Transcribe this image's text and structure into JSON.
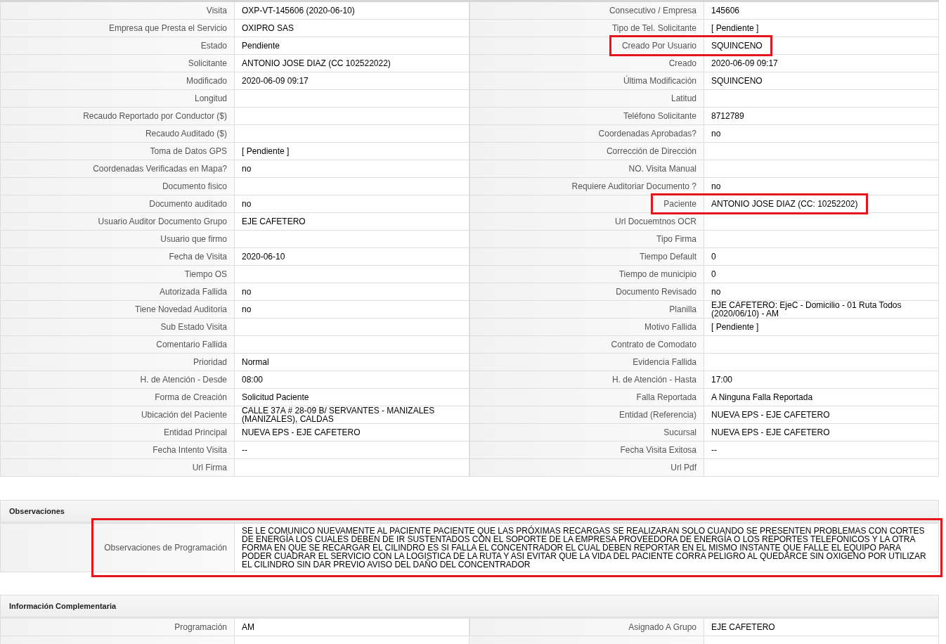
{
  "details": {
    "rows": [
      {
        "left": {
          "label": "Visita",
          "value": "OXP-VT-145606 (2020-06-10)",
          "highlighted": false
        },
        "right": {
          "label": "Consecutivo / Empresa",
          "value": "145606",
          "highlighted": false
        }
      },
      {
        "left": {
          "label": "Empresa que Presta el Servicio",
          "value": "OXIPRO SAS",
          "highlighted": false
        },
        "right": {
          "label": "Tipo de Tel. Solicitante",
          "value": "[ Pendiente ]",
          "highlighted": false
        }
      },
      {
        "left": {
          "label": "Estado",
          "value": "Pendiente",
          "highlighted": false
        },
        "right": {
          "label": "Creado Por Usuario",
          "value": "SQUINCENO",
          "highlighted": true
        }
      },
      {
        "left": {
          "label": "Solicitante",
          "value": "ANTONIO JOSE DIAZ (CC 102522022)",
          "highlighted": false
        },
        "right": {
          "label": "Creado",
          "value": "2020-06-09 09:17",
          "highlighted": false
        }
      },
      {
        "left": {
          "label": "Modificado",
          "value": "2020-06-09 09:17",
          "highlighted": false
        },
        "right": {
          "label": "Última Modificación",
          "value": "SQUINCENO",
          "highlighted": false
        }
      },
      {
        "left": {
          "label": "Longitud",
          "highlighted": false
        },
        "right": {
          "label": "Latitud",
          "highlighted": false
        }
      },
      {
        "left": {
          "label": "Recaudo Reportado por Conductor ($)",
          "highlighted": false
        },
        "right": {
          "label": "Teléfono Solicitante",
          "value": "8712789",
          "highlighted": false
        }
      },
      {
        "left": {
          "label": "Recaudo Auditado ($)",
          "highlighted": false
        },
        "right": {
          "label": "Coordenadas Aprobadas?",
          "value": "no",
          "highlighted": false
        }
      },
      {
        "left": {
          "label": "Toma de Datos GPS",
          "value": "[ Pendiente ]",
          "highlighted": false
        },
        "right": {
          "label": "Corrección de Dirección",
          "highlighted": false
        }
      },
      {
        "left": {
          "label": "Coordenadas Verificadas en Mapa?",
          "value": "no",
          "highlighted": false
        },
        "right": {
          "label": "NO. Visita Manual",
          "highlighted": false
        }
      },
      {
        "left": {
          "label": "Documento fisico",
          "highlighted": false
        },
        "right": {
          "label": "Requiere Auditoriar Documento ?",
          "value": "no",
          "highlighted": false
        }
      },
      {
        "left": {
          "label": "Documento auditado",
          "value": "no",
          "highlighted": false
        },
        "right": {
          "label": "Paciente",
          "value": "ANTONIO JOSE DIAZ (CC: 10252202)",
          "highlighted": true
        }
      },
      {
        "left": {
          "label": "Usuario Auditor Documento Grupo",
          "value": "EJE CAFETERO",
          "highlighted": false
        },
        "right": {
          "label": "Url Docuemtnos OCR",
          "highlighted": false
        }
      },
      {
        "left": {
          "label": "Usuario que firmo",
          "highlighted": false
        },
        "right": {
          "label": "Tipo Firma",
          "highlighted": false
        }
      },
      {
        "left": {
          "label": "Fecha de Visita",
          "value": "2020-06-10",
          "highlighted": false
        },
        "right": {
          "label": "Tiempo Default",
          "value": "0",
          "highlighted": false
        }
      },
      {
        "left": {
          "label": "Tiempo OS",
          "highlighted": false
        },
        "right": {
          "label": "Tiempo de municipio",
          "value": "0",
          "highlighted": false
        }
      },
      {
        "left": {
          "label": "Autorizada Fallida",
          "value": "no",
          "highlighted": false
        },
        "right": {
          "label": "Documento Revisado",
          "value": "no",
          "highlighted": false
        }
      },
      {
        "left": {
          "label": "Tiene Novedad Auditoria",
          "value": "no",
          "highlighted": false
        },
        "right": {
          "label": "Planilla",
          "value": "EJE CAFETERO: EjeC - Domicilio - 01 Ruta Todos (2020/06/10) - AM",
          "highlighted": false
        }
      },
      {
        "left": {
          "label": "Sub Estado Visita",
          "highlighted": false
        },
        "right": {
          "label": "Motivo Fallida",
          "value": "[ Pendiente ]",
          "highlighted": false
        }
      },
      {
        "left": {
          "label": "Comentario Fallida",
          "highlighted": false
        },
        "right": {
          "label": "Contrato de Comodato",
          "highlighted": false
        }
      },
      {
        "left": {
          "label": "Prioridad",
          "value": "Normal",
          "highlighted": false
        },
        "right": {
          "label": "Evidencia Fallida",
          "highlighted": false
        }
      },
      {
        "left": {
          "label": "H. de Atención - Desde",
          "value": "08:00",
          "highlighted": false
        },
        "right": {
          "label": "H. de Atención - Hasta",
          "value": "17:00",
          "highlighted": false
        }
      },
      {
        "left": {
          "label": "Forma de Creación",
          "value": "Solicitud Paciente",
          "highlighted": false
        },
        "right": {
          "label": "Falla Reportada",
          "value": "A Ninguna Falla Reportada",
          "highlighted": false
        }
      },
      {
        "left": {
          "label": "Ubicación del Paciente",
          "value": "CALLE 37A # 28-09 B/ SERVANTES - MANIZALES (MANIZALES), CALDAS",
          "highlighted": false
        },
        "right": {
          "label": "Entidad (Referencia)",
          "value": "NUEVA EPS - EJE CAFETERO",
          "highlighted": false
        }
      },
      {
        "left": {
          "label": "Entidad Principal",
          "value": "NUEVA EPS - EJE CAFETERO",
          "highlighted": false
        },
        "right": {
          "label": "Sucursal",
          "value": "NUEVA EPS - EJE CAFETERO",
          "highlighted": false
        }
      },
      {
        "left": {
          "label": "Fecha Intento Visita",
          "value": "--",
          "highlighted": false
        },
        "right": {
          "label": "Fecha Visita Exitosa",
          "value": "--",
          "highlighted": false
        }
      },
      {
        "left": {
          "label": "Url Firma",
          "highlighted": false
        },
        "right": {
          "label": "Url Pdf",
          "highlighted": false
        }
      }
    ]
  },
  "observations": {
    "title": "Observaciones",
    "rows": [
      {
        "label": "Observaciones de Programación",
        "value": "SE LE COMUNICO NUEVAMENTE AL PACIENTE PACIENTE QUE LAS PRÓXIMAS RECARGAS SE REALIZARAN SOLO CUANDO SE PRESENTEN PROBLEMAS CON CORTES DE ENERGÍA LOS CUALES DEBEN DE IR SUSTENTADOS CON EL SOPORTE DE LA EMPRESA PROVEEDORA DE ENERGÍA O LOS REPORTES TELEFONICOS Y LA OTRA FORMA EN QUE SE RECARGAR EL CILINDRO ES SI FALLA EL CONCENTRADOR EL CUAL DEBEN REPORTAR EN EL MISMO INSTANTE QUE FALLE EL EQUIPO PARA PODER CUADRAR EL SERVICIO CON LA LOGISTICA DE LA RUTA Y ASI EVITAR QUE LA VIDA DEL PACIENTE CORRA PELIGRO AL QUEDARCE SIN OXIGENO POR UTILIZAR EL CILINDRO SIN DAR PREVIO AVISO DEL DAÑO DEL CONCENTRADOR",
        "highlighted": true
      }
    ]
  },
  "complementary": {
    "title": "Información Complementaria",
    "rows": [
      {
        "left": {
          "label": "Programación",
          "value": "AM",
          "highlighted": false
        },
        "right": {
          "label": "Asignado A Grupo",
          "value": "EJE CAFETERO",
          "highlighted": false
        }
      }
    ]
  }
}
